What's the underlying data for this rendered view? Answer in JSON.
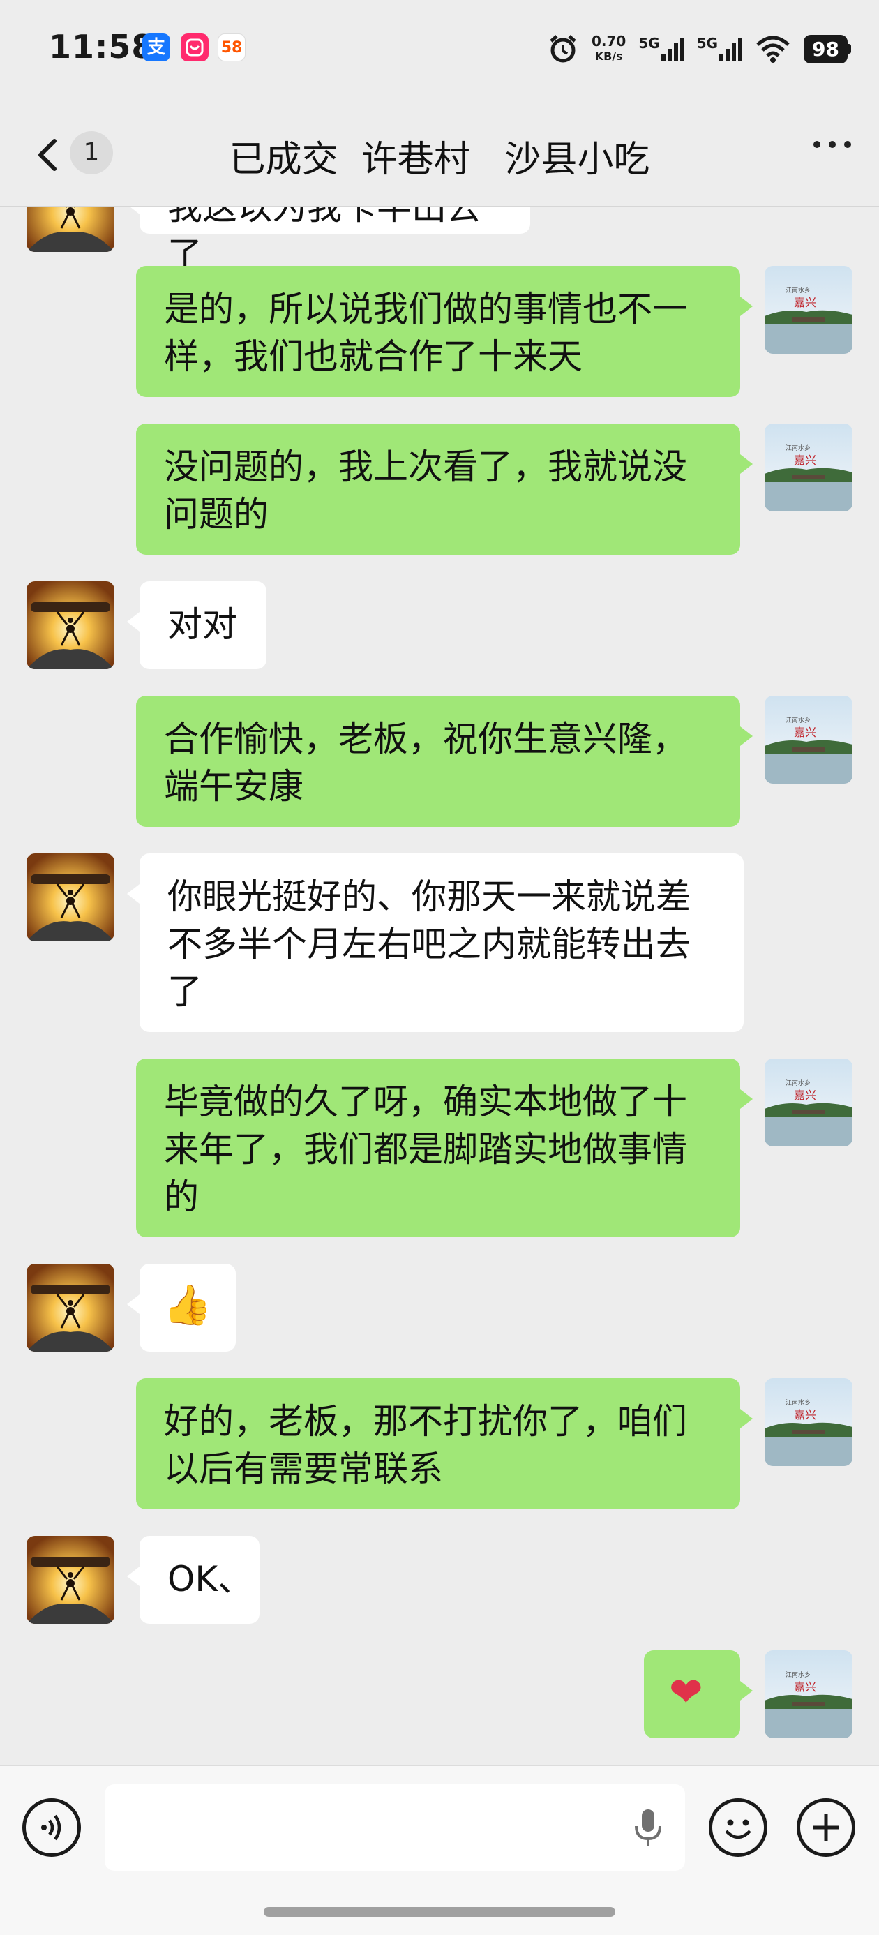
{
  "status_bar": {
    "time": "11:58",
    "apps": [
      {
        "name": "alipay-icon",
        "glyph": "支",
        "color": "#1677ff"
      },
      {
        "name": "shopping-app-icon",
        "glyph": "◡",
        "color": "#ff2a6d"
      },
      {
        "name": "58-app-icon",
        "glyph": "58",
        "color": "#ffffff"
      }
    ],
    "net_speed_value": "0.70",
    "net_speed_unit": "KB/s",
    "signal_1": "5G",
    "signal_2": "5G",
    "battery": "98"
  },
  "header": {
    "unread_count": "1",
    "title": "已成交  许巷村   沙县小吃"
  },
  "messages": [
    {
      "side": "left",
      "text": "我这以为我卡半出去了"
    },
    {
      "side": "right",
      "text": "是的，所以说我们做的事情也不一样，我们也就合作了十来天"
    },
    {
      "side": "right",
      "text": "没问题的，我上次看了，我就说没问题的"
    },
    {
      "side": "left",
      "text": "对对"
    },
    {
      "side": "right",
      "text": "合作愉快，老板，祝你生意兴隆，端午安康"
    },
    {
      "side": "left",
      "text": "你眼光挺好的、你那天一来就说差不多半个月左右吧之内就能转出去了"
    },
    {
      "side": "right",
      "text": "毕竟做的久了呀，确实本地做了十来年了，我们都是脚踏实地做事情的"
    },
    {
      "side": "left",
      "text": "👍"
    },
    {
      "side": "right",
      "text": "好的，老板，那不打扰你了，咱们以后有需要常联系"
    },
    {
      "side": "left",
      "text": "OK、"
    },
    {
      "side": "right",
      "text": "❤"
    }
  ],
  "my_avatar": {
    "label_line1": "江南水乡",
    "label_line2": "嘉兴"
  },
  "colors": {
    "green_bubble": "#a0e777",
    "background": "#ededed"
  },
  "input_bar": {
    "voice_icon": "voice-icon",
    "emoji_icon": "emoji-icon",
    "plus_icon": "plus-icon",
    "mic_icon": "microphone-icon"
  }
}
